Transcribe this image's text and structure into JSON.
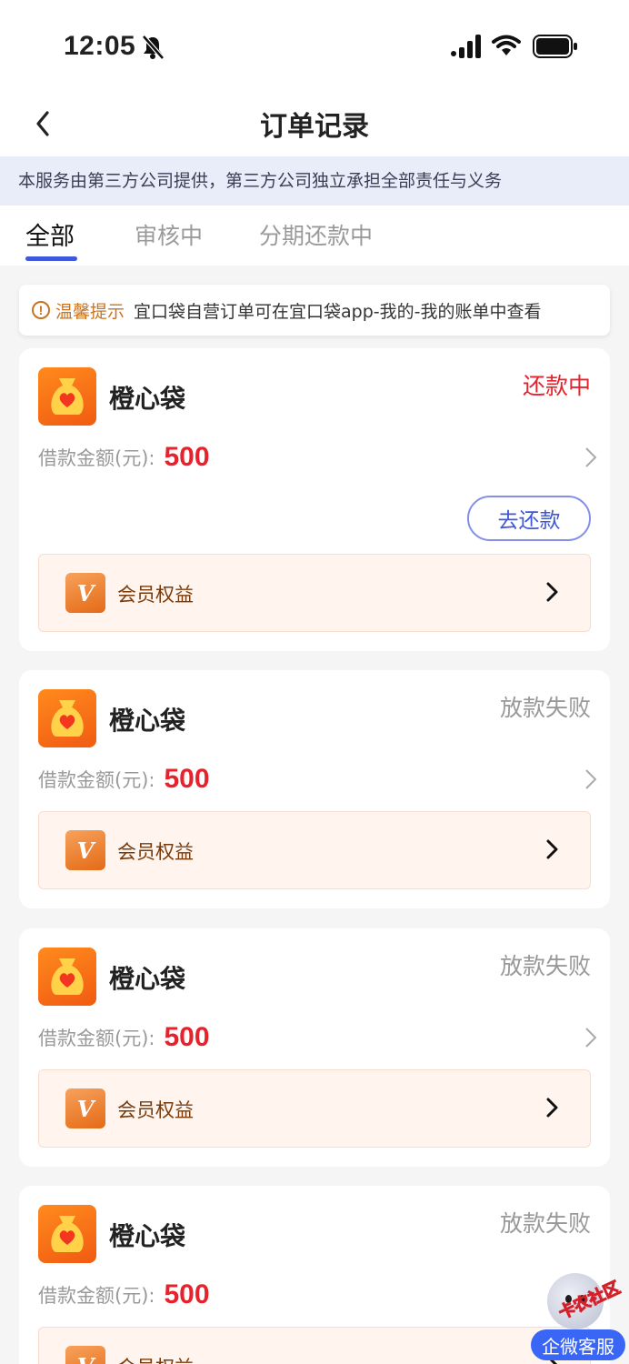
{
  "status_bar": {
    "time": "12:05"
  },
  "header": {
    "title": "订单记录"
  },
  "notice": "本服务由第三方公司提供，第三方公司独立承担全部责任与义务",
  "tabs": [
    {
      "label": "全部",
      "active": true
    },
    {
      "label": "审核中",
      "active": false
    },
    {
      "label": "分期还款中",
      "active": false
    }
  ],
  "tip": {
    "label": "温馨提示",
    "text": "宜口袋自营订单可在宜口袋app-我的-我的账单中查看"
  },
  "orders": [
    {
      "product": "橙心袋",
      "status": "还款中",
      "amount_label": "借款金额(元):",
      "amount": "500",
      "action": "去还款",
      "benefit": "会员权益"
    },
    {
      "product": "橙心袋",
      "status": "放款失败",
      "amount_label": "借款金额(元):",
      "amount": "500",
      "benefit": "会员权益"
    },
    {
      "product": "橙心袋",
      "status": "放款失败",
      "amount_label": "借款金额(元):",
      "amount": "500",
      "benefit": "会员权益"
    },
    {
      "product": "橙心袋",
      "status": "放款失败",
      "amount_label": "借款金额(元):",
      "amount": "500",
      "benefit": "会员权益"
    }
  ],
  "floating": {
    "tag": "卡农社区",
    "button": "企微客服"
  },
  "colors": {
    "accent": "#3f57d9",
    "amount": "#e8222d",
    "status_active": "#e8222d",
    "status_failed": "#999999",
    "brand_orange": "#f26a16"
  }
}
